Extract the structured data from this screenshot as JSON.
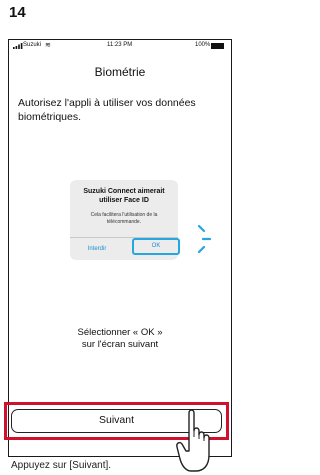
{
  "step": {
    "number": "14"
  },
  "status_bar": {
    "carrier": "Suzuki",
    "time": "11:23 PM",
    "battery": "100%"
  },
  "screen": {
    "title": "Biométrie",
    "description": "Autorisez l'appli à utiliser vos données biométriques.",
    "instruction_line1": "Sélectionner « OK »",
    "instruction_line2": "sur l'écran suivant",
    "next_label": "Suivant"
  },
  "dialog": {
    "title_line1": "Suzuki Connect aimerait",
    "title_line2": "utiliser Face ID",
    "message_line1": "Cela facilitera l'utilisation de la",
    "message_line2": "télécommande.",
    "deny_label": "Interdir",
    "ok_label": "OK"
  },
  "caption": "Appuyez sur [Suivant].",
  "colors": {
    "highlight": "#d0102c",
    "accent": "#27a5e0"
  }
}
